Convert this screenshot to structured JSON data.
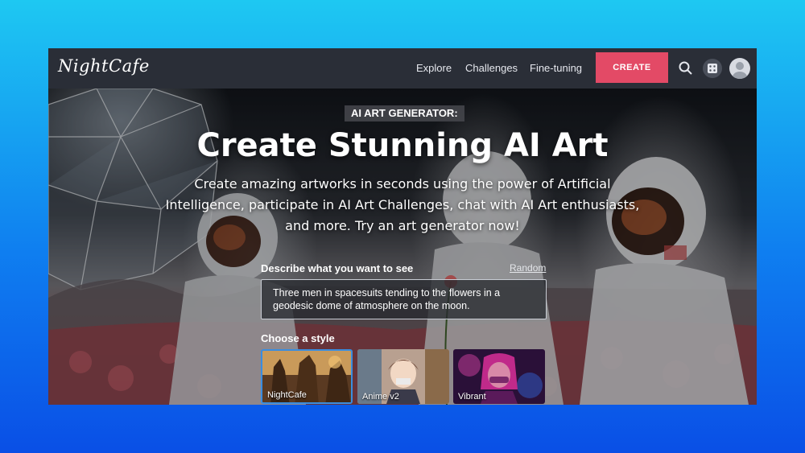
{
  "nav": {
    "logo": "NightCafe",
    "links": [
      "Explore",
      "Challenges",
      "Fine-tuning"
    ],
    "create_label": "CREATE",
    "icons": [
      "search-icon",
      "dice-icon",
      "avatar"
    ]
  },
  "hero": {
    "badge": "AI ART GENERATOR:",
    "headline": "Create Stunning AI Art",
    "subtext": "Create amazing artworks in seconds using the power of Artificial Intelligence, participate in AI Art Challenges, chat with AI Art enthusiasts, and more. Try an art generator now!"
  },
  "prompt": {
    "label": "Describe what you want to see",
    "random_label": "Random",
    "value": "Three men in spacesuits tending to the flowers in a geodesic dome of atmosphere on the moon."
  },
  "styles": {
    "label": "Choose a style",
    "items": [
      {
        "name": "NightCafe",
        "selected": true
      },
      {
        "name": "Anime v2",
        "selected": false
      },
      {
        "name": "Vibrant",
        "selected": false
      }
    ]
  },
  "colors": {
    "accent": "#e34a66",
    "nav_bg": "#2a2e37",
    "selected_border": "#3a8de0"
  }
}
